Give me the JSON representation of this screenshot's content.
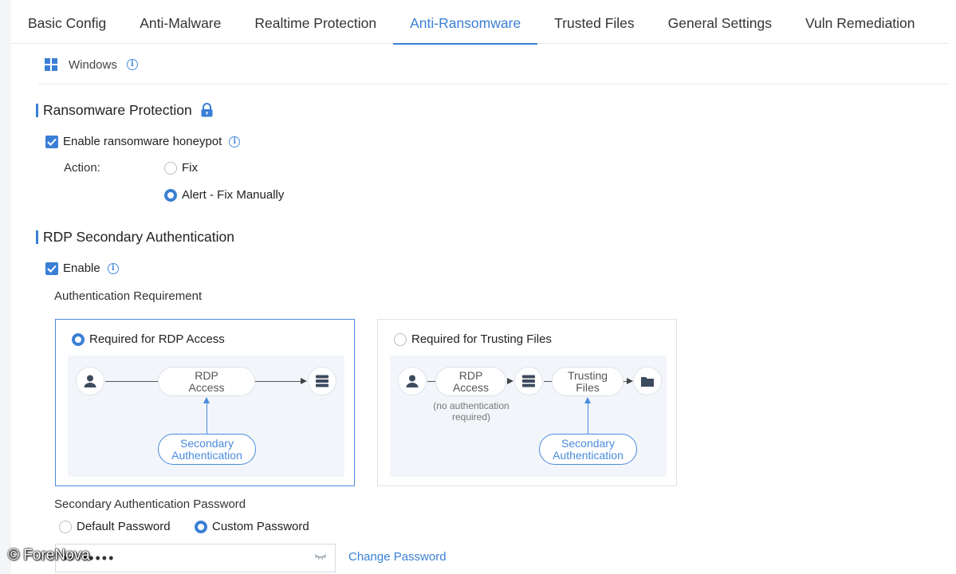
{
  "tabs": [
    {
      "label": "Basic Config"
    },
    {
      "label": "Anti-Malware"
    },
    {
      "label": "Realtime Protection"
    },
    {
      "label": "Anti-Ransomware"
    },
    {
      "label": "Trusted Files"
    },
    {
      "label": "General Settings"
    },
    {
      "label": "Vuln Remediation"
    }
  ],
  "active_tab": "Anti-Ransomware",
  "os": {
    "label": "Windows",
    "icon": "windows-icon"
  },
  "ransomware": {
    "title": "Ransomware Protection",
    "honeypot_label": "Enable ransomware honeypot",
    "honeypot_checked": true,
    "action_label": "Action:",
    "options": [
      "Fix",
      "Alert - Fix Manually"
    ],
    "selected_option": "Alert - Fix Manually"
  },
  "rdp": {
    "title": "RDP Secondary Authentication",
    "enable_label": "Enable",
    "enable_checked": true,
    "requirement_label": "Authentication Requirement",
    "card1": {
      "label": "Required for RDP Access",
      "selected": true,
      "node_rdp_line1": "RDP",
      "node_rdp_line2": "Access",
      "node_sec_line1": "Secondary",
      "node_sec_line2": "Authentication"
    },
    "card2": {
      "label": "Required for Trusting Files",
      "selected": false,
      "node_rdp_line1": "RDP",
      "node_rdp_line2": "Access",
      "note_line1": "(no authentication",
      "note_line2": "required)",
      "node_trust_line1": "Trusting",
      "node_trust_line2": "Files",
      "node_sec_line1": "Secondary",
      "node_sec_line2": "Authentication"
    },
    "password_label": "Secondary Authentication Password",
    "password_options": [
      "Default Password",
      "Custom Password"
    ],
    "password_selected": "Custom Password",
    "password_value": "••••••••",
    "change_password_label": "Change Password"
  },
  "watermark": "© ForeNova",
  "colors": {
    "accent": "#3a7fd5",
    "text": "#333333",
    "border": "#dfe2e6"
  }
}
